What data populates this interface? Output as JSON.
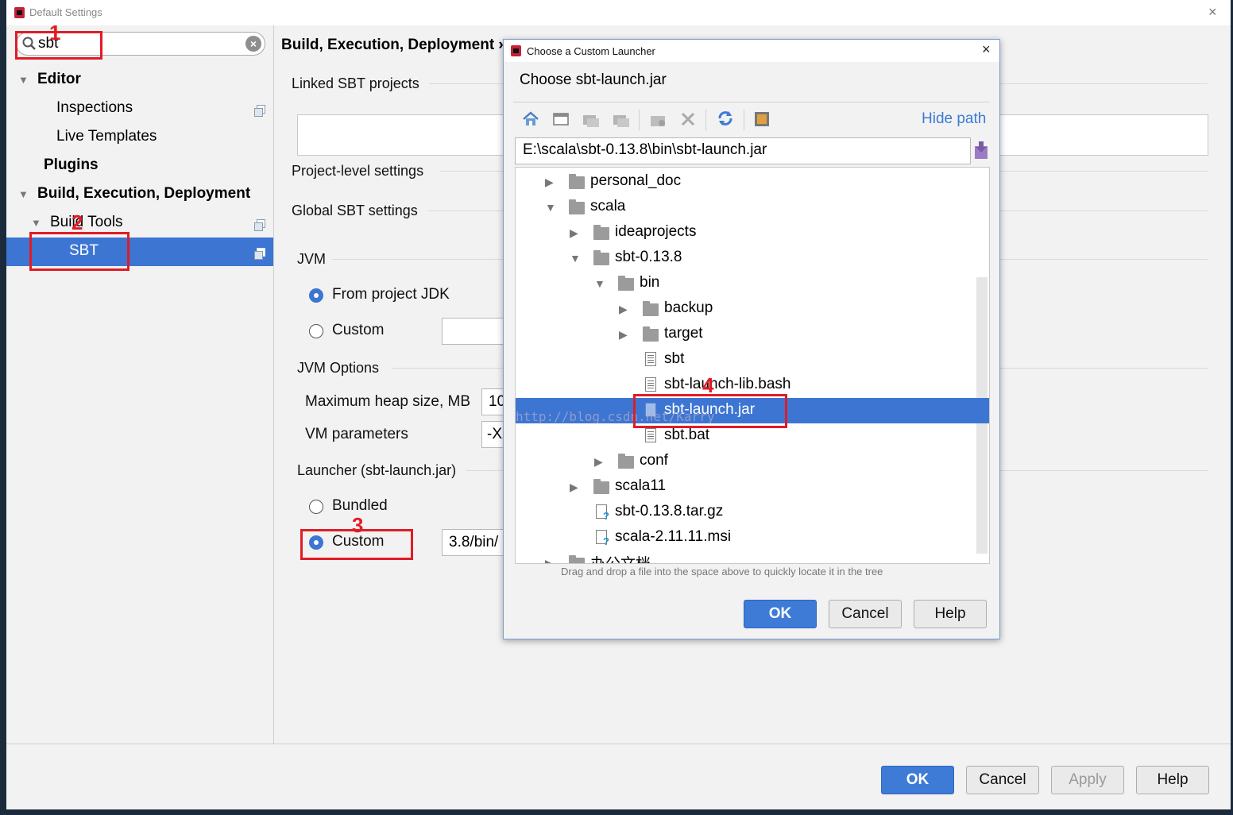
{
  "window": {
    "title": "Default Settings",
    "close_glyph": "×"
  },
  "search": {
    "value": "sbt",
    "clear_glyph": "×"
  },
  "sidebar": {
    "items": [
      {
        "label": "Editor"
      },
      {
        "label": "Inspections"
      },
      {
        "label": "Live Templates"
      },
      {
        "label": "Plugins"
      },
      {
        "label": "Build, Execution, Deployment"
      },
      {
        "label": "Build Tools"
      },
      {
        "label": "SBT"
      }
    ]
  },
  "annotations": [
    "1",
    "2",
    "3",
    "4"
  ],
  "content": {
    "breadcrumb": "Build, Execution, Deployment ›",
    "linked_projects": "Linked SBT projects",
    "project_level": "Project-level settings",
    "global": "Global SBT settings",
    "jvm": "JVM",
    "from_project_jdk": "From project JDK",
    "custom": "Custom",
    "jvm_options": "JVM Options",
    "max_heap": "Maximum heap size, MB",
    "max_heap_value": "10",
    "vm_params": "VM parameters",
    "vm_params_value": "-XX:M",
    "launcher": "Launcher (sbt-launch.jar)",
    "bundled": "Bundled",
    "custom2": "Custom",
    "launcher_path": "3.8/bin/"
  },
  "buttons": {
    "ok": "OK",
    "cancel": "Cancel",
    "apply": "Apply",
    "help": "Help"
  },
  "dialog": {
    "title": "Choose a Custom Launcher",
    "header": "Choose sbt-launch.jar",
    "hide_path": "Hide path",
    "path": "E:\\scala\\sbt-0.13.8\\bin\\sbt-launch.jar",
    "tree": [
      {
        "label": "personal_doc",
        "type": "folder",
        "expanded": false
      },
      {
        "label": "scala",
        "type": "folder",
        "expanded": true
      },
      {
        "label": "ideaprojects",
        "type": "folder",
        "expanded": false
      },
      {
        "label": "sbt-0.13.8",
        "type": "folder",
        "expanded": true
      },
      {
        "label": "bin",
        "type": "folder",
        "expanded": true
      },
      {
        "label": "backup",
        "type": "folder",
        "expanded": false
      },
      {
        "label": "target",
        "type": "folder",
        "expanded": false
      },
      {
        "label": "sbt",
        "type": "file"
      },
      {
        "label": "sbt-launch-lib.bash",
        "type": "file"
      },
      {
        "label": "sbt-launch.jar",
        "type": "jar",
        "selected": true
      },
      {
        "label": "sbt.bat",
        "type": "file"
      },
      {
        "label": "conf",
        "type": "folder",
        "expanded": false
      },
      {
        "label": "scala11",
        "type": "folder",
        "expanded": false
      },
      {
        "label": "sbt-0.13.8.tar.gz",
        "type": "unknown"
      },
      {
        "label": "scala-2.11.11.msi",
        "type": "unknown"
      },
      {
        "label": "办公文档",
        "type": "folder",
        "expanded": false
      }
    ],
    "drag_hint": "Drag and drop a file into the space above to quickly locate it in the tree",
    "ok": "OK",
    "cancel": "Cancel",
    "help": "Help",
    "watermark": "http://blog.csdn.net/Karry"
  },
  "colors": {
    "accent": "#3d75d3",
    "annotation": "#e21b24"
  }
}
